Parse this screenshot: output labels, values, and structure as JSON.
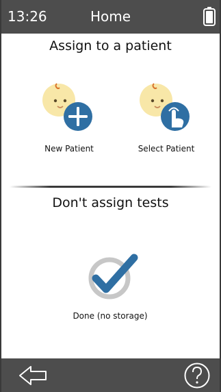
{
  "status_bar": {
    "time": "13:26",
    "title": "Home",
    "battery_icon": "battery-icon"
  },
  "assign_section": {
    "heading": "Assign to a patient",
    "options": [
      {
        "label": "New Patient",
        "icon": "baby-plus-icon"
      },
      {
        "label": "Select Patient",
        "icon": "baby-touch-icon"
      }
    ]
  },
  "no_assign_section": {
    "heading": "Don't assign tests",
    "done_label": "Done (no storage)",
    "done_icon": "check-circle-icon"
  },
  "bottom_bar": {
    "back_icon": "back-arrow-icon",
    "help_icon": "help-icon"
  },
  "colors": {
    "bar": "#4d4d4d",
    "accent": "#2f6fa3",
    "face": "#f8e7a8",
    "check_ring": "#c7c7c7"
  }
}
